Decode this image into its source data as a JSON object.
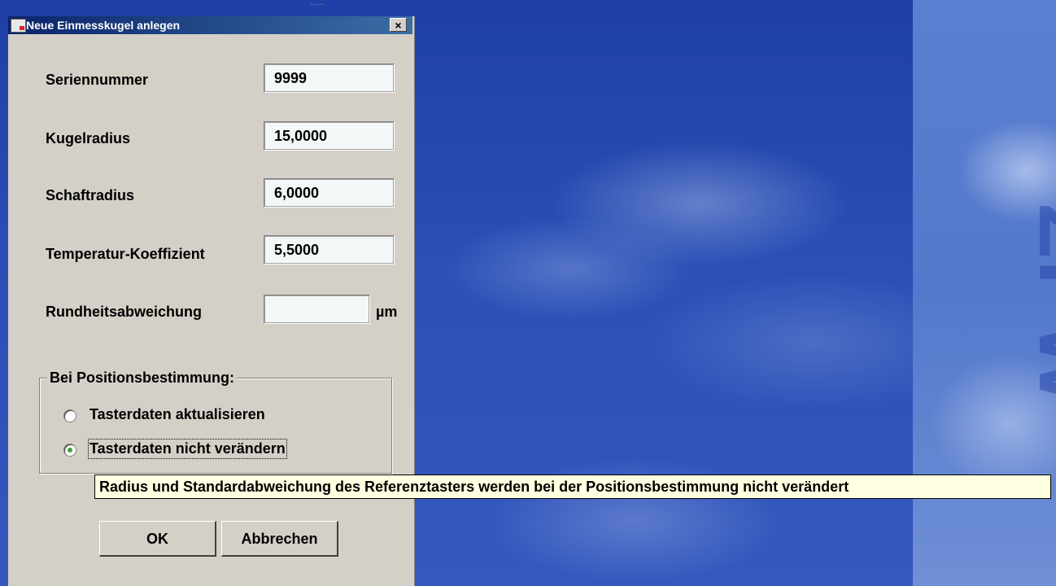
{
  "dialog": {
    "title": "Neue Einmesskugel anlegen",
    "close_label": "×"
  },
  "fields": {
    "seriennummer": {
      "label": "Seriennummer",
      "value": "9999"
    },
    "kugelradius": {
      "label": "Kugelradius",
      "value": "15,0000"
    },
    "schaftradius": {
      "label": "Schaftradius",
      "value": "6,0000"
    },
    "temperatur": {
      "label": "Temperatur-Koeffizient",
      "value": "5,5000"
    },
    "rundheit": {
      "label": "Rundheitsabweichung",
      "value": "",
      "unit": "µm"
    }
  },
  "position_group": {
    "legend": "Bei Positionsbestimmung:",
    "options": [
      {
        "label": "Tasterdaten aktualisieren",
        "checked": false
      },
      {
        "label": "Tasterdaten nicht verändern",
        "checked": true
      }
    ]
  },
  "tooltip": {
    "text": "Radius und Standardabweichung des Referenztasters werden bei der Positionsbestimmung nicht verändert"
  },
  "buttons": {
    "ok_label": "OK",
    "cancel_label": "Abbrechen"
  },
  "background": {
    "brand_text": "ZPW"
  },
  "colors": {
    "titlebar_start": "#0a246a",
    "titlebar_end": "#3a6ea5",
    "dialog_bg": "#d4d0c8",
    "tooltip_bg": "#ffffe1",
    "radio_check": "#3aa43a"
  }
}
